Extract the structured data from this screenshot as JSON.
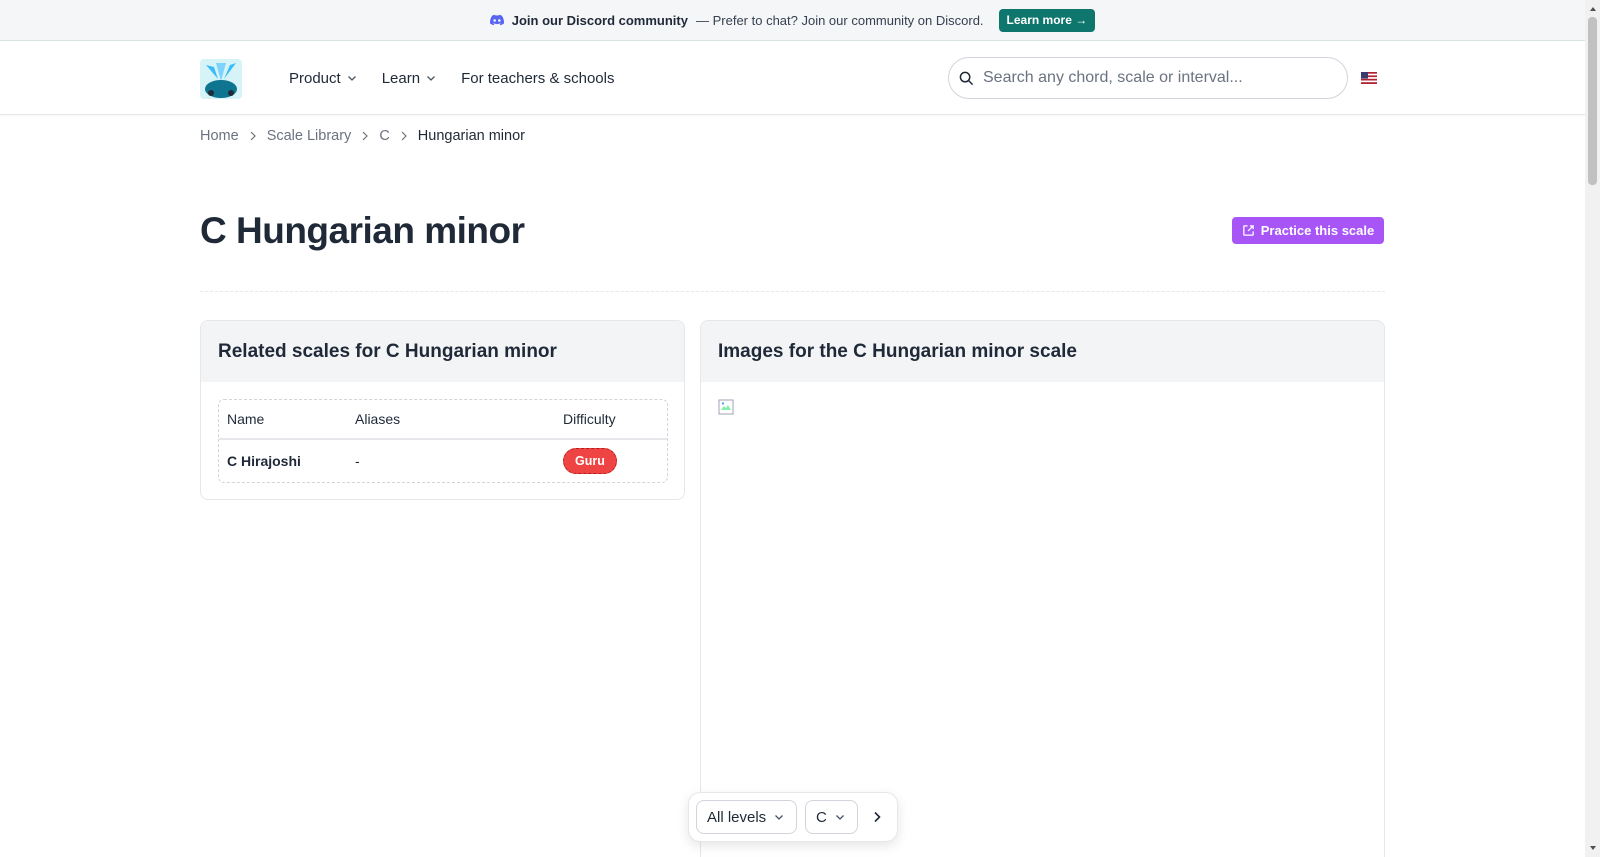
{
  "banner": {
    "title": "Join our Discord community",
    "message": "— Prefer to chat? Join our community on Discord.",
    "button": "Learn more →"
  },
  "nav": {
    "items": [
      {
        "label": "Product",
        "has_dropdown": true
      },
      {
        "label": "Learn",
        "has_dropdown": true
      },
      {
        "label": "For teachers & schools",
        "has_dropdown": false
      }
    ]
  },
  "search": {
    "placeholder": "Search any chord, scale or interval..."
  },
  "breadcrumb": [
    "Home",
    "Scale Library",
    "C",
    "Hungarian minor"
  ],
  "page": {
    "title": "C Hungarian minor",
    "practice_button": "Practice this scale"
  },
  "related": {
    "heading": "Related scales for C Hungarian minor",
    "columns": [
      "Name",
      "Aliases",
      "Difficulty"
    ],
    "rows": [
      {
        "name": "C Hirajoshi",
        "aliases": "-",
        "difficulty": "Guru"
      }
    ]
  },
  "images": {
    "heading": "Images for the C Hungarian minor scale"
  },
  "filters": {
    "level": "All levels",
    "key": "C"
  },
  "colors": {
    "accent_teal": "#0f766e",
    "practice_purple": "#a855f7",
    "badge_red": "#ef4444"
  }
}
